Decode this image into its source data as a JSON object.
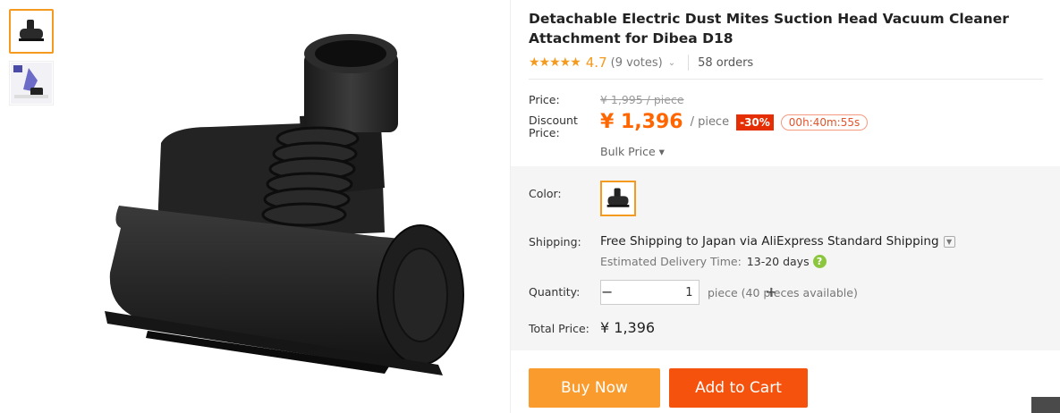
{
  "thumbnails": [
    {
      "icon": "vacuum-head-thumb",
      "active": true
    },
    {
      "icon": "vacuum-usage-thumb",
      "active": false
    }
  ],
  "main_image": {
    "icon": "vacuum-attachment-image"
  },
  "product": {
    "title": "Detachable Electric Dust Mites Suction Head Vacuum Cleaner Attachment for Dibea D18",
    "rating_value": "4.7",
    "votes": "(9 votes)",
    "orders": "58 orders"
  },
  "price": {
    "label": "Price:",
    "original": "¥ 1,995 / piece",
    "discount_label": "Discount Price:",
    "current": "¥ 1,396",
    "unit": "/ piece",
    "discount_badge": "-30%",
    "timer": "00h:40m:55s",
    "bulk_price": "Bulk Price ▾"
  },
  "options": {
    "color_label": "Color:",
    "shipping_label": "Shipping:",
    "shipping_text": "Free Shipping to Japan via AliExpress Standard Shipping",
    "delivery_label": "Estimated Delivery Time:",
    "delivery_days": "13-20 days",
    "quantity_label": "Quantity:",
    "quantity_value": "1",
    "quantity_info": "piece (40 pieces available)",
    "total_label": "Total Price:",
    "total_value": "¥ 1,396"
  },
  "actions": {
    "buy_now": "Buy Now",
    "add_to_cart": "Add to Cart"
  },
  "colors": {
    "accent": "#f49a1e",
    "price": "#ff6600",
    "buy_now_bg": "#fa9b2e",
    "add_to_cart_bg": "#f5530d",
    "badge": "#e62e04"
  }
}
